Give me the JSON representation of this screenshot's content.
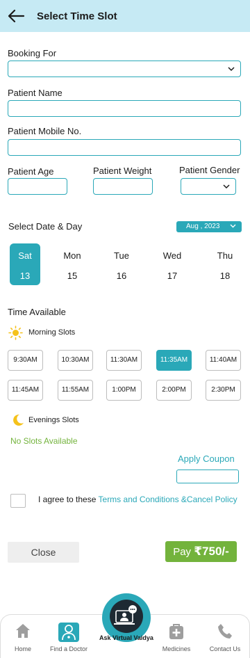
{
  "header": {
    "title": "Select Time Slot"
  },
  "form": {
    "booking_for_label": "Booking For",
    "patient_name_label": "Patient Name",
    "patient_mobile_label": "Patient Mobile No.",
    "patient_age_label": "Patient Age",
    "patient_weight_label": "Patient Weight",
    "patient_gender_label": "Patient Gender"
  },
  "date": {
    "title": "Select Date & Day",
    "month_selector": "Aug , 2023",
    "days": [
      {
        "name": "Sat",
        "num": "13",
        "selected": true
      },
      {
        "name": "Mon",
        "num": "15",
        "selected": false
      },
      {
        "name": "Tue",
        "num": "16",
        "selected": false
      },
      {
        "name": "Wed",
        "num": "17",
        "selected": false
      },
      {
        "name": "Thu",
        "num": "18",
        "selected": false
      }
    ]
  },
  "time": {
    "title": "Time Available",
    "morning_label": "Morning Slots",
    "morning_slots": [
      "9:30AM",
      "10:30AM",
      "11:30AM",
      "11:35AM",
      "11:40AM",
      "11:45AM",
      "11:55AM",
      "1:00PM",
      "2:00PM",
      "2:30PM"
    ],
    "selected_slot": "11:35AM",
    "evening_label": "Evenings Slots",
    "no_slots": "No Slots Available"
  },
  "coupon": {
    "label": "Apply Coupon",
    "value": ""
  },
  "agree": {
    "prefix": "I agree to these ",
    "link": "Terms and Conditions &Cancel Policy"
  },
  "actions": {
    "close_label": "Close",
    "pay_prefix": "Pay ",
    "pay_amount": "₹750/-"
  },
  "nav": {
    "home": "Home",
    "find_doctor": "Find a Doctor",
    "ask_vaidya": "Ask Virtual Vaidya",
    "medicines": "Medicines",
    "contact": "Contact Us"
  },
  "colors": {
    "accent": "#2aa8b8",
    "header_bg": "#c6eaf4",
    "pay_green": "#73b33c"
  }
}
